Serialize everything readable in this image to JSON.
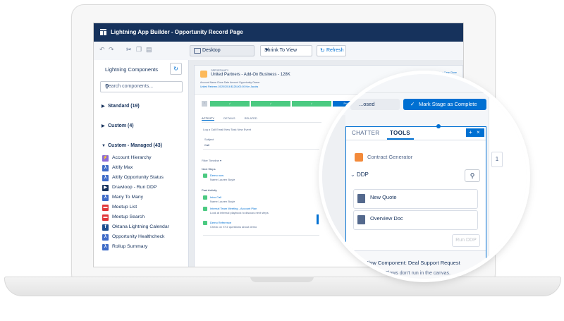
{
  "window": {
    "title": "Lightning App Builder - Opportunity Record Page"
  },
  "toolbar": {
    "undo_icon": "undo-icon",
    "redo_icon": "redo-icon",
    "cut_icon": "cut-icon",
    "copy_icon": "copy-icon",
    "paste_icon": "paste-icon",
    "device_label": "Desktop",
    "zoom_label": "Shrink To View",
    "refresh_label": "Refresh"
  },
  "left_panel": {
    "title": "Lightning Components",
    "search_placeholder": "Search components...",
    "categories": [
      {
        "label": "Standard (19)",
        "expanded": false
      },
      {
        "label": "Custom (4)",
        "expanded": false
      },
      {
        "label": "Custom - Managed (43)",
        "expanded": true
      }
    ],
    "items": [
      {
        "label": "Account Hierarchy",
        "color": "#8b6bd8",
        "glyph": "⚡"
      },
      {
        "label": "Altify Max",
        "color": "#3e6bc7",
        "glyph": "λ"
      },
      {
        "label": "Altify Opportunity Status",
        "color": "#3e6bc7",
        "glyph": "λ"
      },
      {
        "label": "Drawloop - Run DDP",
        "color": "#16325c",
        "glyph": "▶"
      },
      {
        "label": "Many To Many",
        "color": "#3e6bc7",
        "glyph": "λ"
      },
      {
        "label": "Meetup List",
        "color": "#e0373a",
        "glyph": "▬"
      },
      {
        "label": "Meetup Search",
        "color": "#e0373a",
        "glyph": "▬"
      },
      {
        "label": "Oktana Lightning Calendar",
        "color": "#1a4d8f",
        "glyph": "f"
      },
      {
        "label": "Opportunity Healthcheck",
        "color": "#3e6bc7",
        "glyph": "λ"
      },
      {
        "label": "Rollup Summary",
        "color": "#3e6bc7",
        "glyph": "λ"
      }
    ]
  },
  "record": {
    "type_label": "OPPORTUNITY",
    "name": "United Partners - Add-On Business - 128K",
    "fields": "Account Name   Close Date   Amount   Opportunity Owner",
    "field_values": "United Partners   10/20/2016   $128,000.00   Kim Jacobs",
    "actions": "✓ Following   Edit   New Case   Clone",
    "path_stages": [
      "✓",
      "✓",
      "✓",
      "Proposal/Quote",
      "Negot..."
    ],
    "tabs": [
      "ACTIVITY",
      "DETAILS",
      "RELATED"
    ],
    "activity_tabs": "Log a Call   Email   New Task   New Event",
    "subject_label": "Subject",
    "subject_value": "Call",
    "filter_label": "Filter Timeline ▾",
    "next_steps": "Next Steps",
    "past_activity": "Past Activity",
    "timeline": [
      {
        "title": "Demo now",
        "sub": "Name    Lauren Boyle"
      },
      {
        "title": "Intro Call",
        "sub": "Name    Lauren Boyle"
      },
      {
        "title": "Internal Team Meeting - Account Plan",
        "sub": "Look at internal playbook to discuss next steps"
      },
      {
        "title": "Demo Reference",
        "sub": "Check on XYZ questions about demo"
      }
    ]
  },
  "magnifier": {
    "stage_prev_label": "...osed",
    "stage_button": "Mark Stage as Complete",
    "tabs": [
      "CHATTER",
      "TOOLS"
    ],
    "active_tab": "TOOLS",
    "panel_controls": [
      "+",
      "×"
    ],
    "contract_generator": "Contract Generator",
    "ddp_label": "DDP",
    "documents": [
      "New Quote",
      "Overview Doc"
    ],
    "run_button": "Run DDP",
    "flow_label": "Flow Component:  Deal Support Request",
    "flow_note": "...placeholder. Flows don't run in the canvas."
  }
}
